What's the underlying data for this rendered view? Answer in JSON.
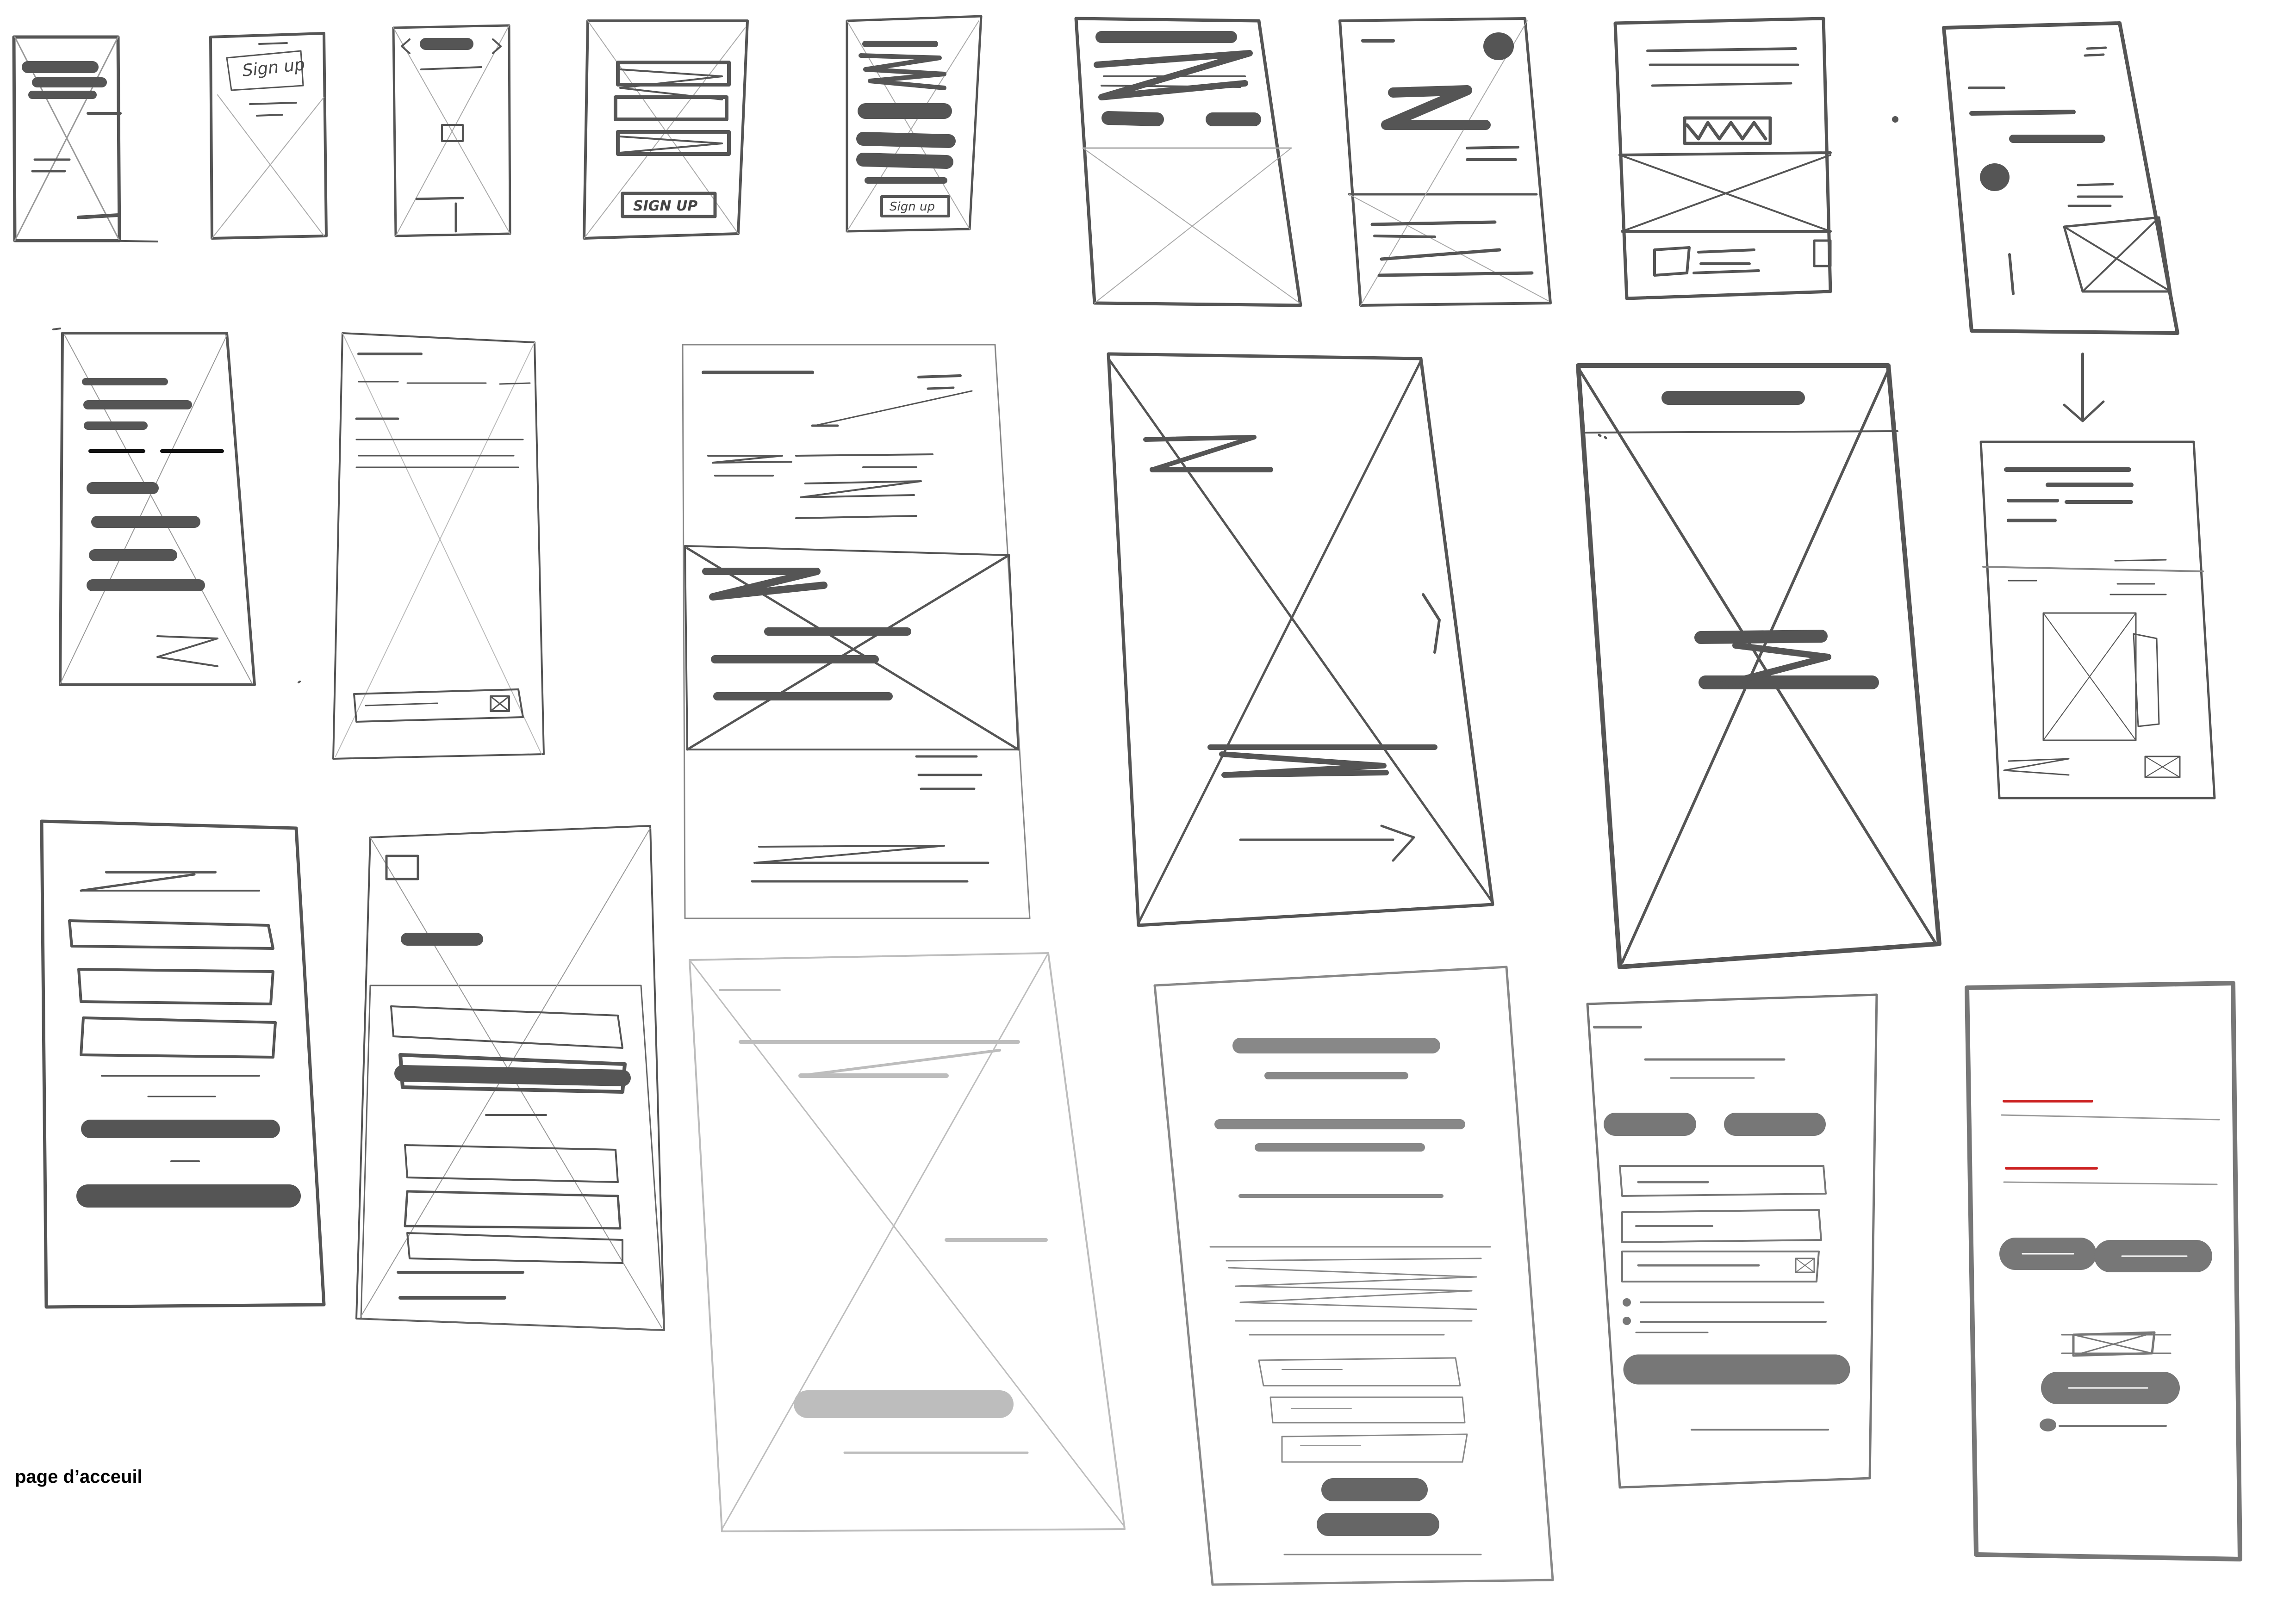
{
  "page_caption": "page d’acceuil",
  "sketch_labels": {
    "signup_1": "Sign up",
    "signup_2": "SIGN UP",
    "signup_3": "Sign up"
  },
  "colors": {
    "ink": "#555555",
    "ink_dark": "#444444",
    "ink_light": "#bdbdbd",
    "accent_red": "#cc2222",
    "paper": "#ffffff"
  }
}
